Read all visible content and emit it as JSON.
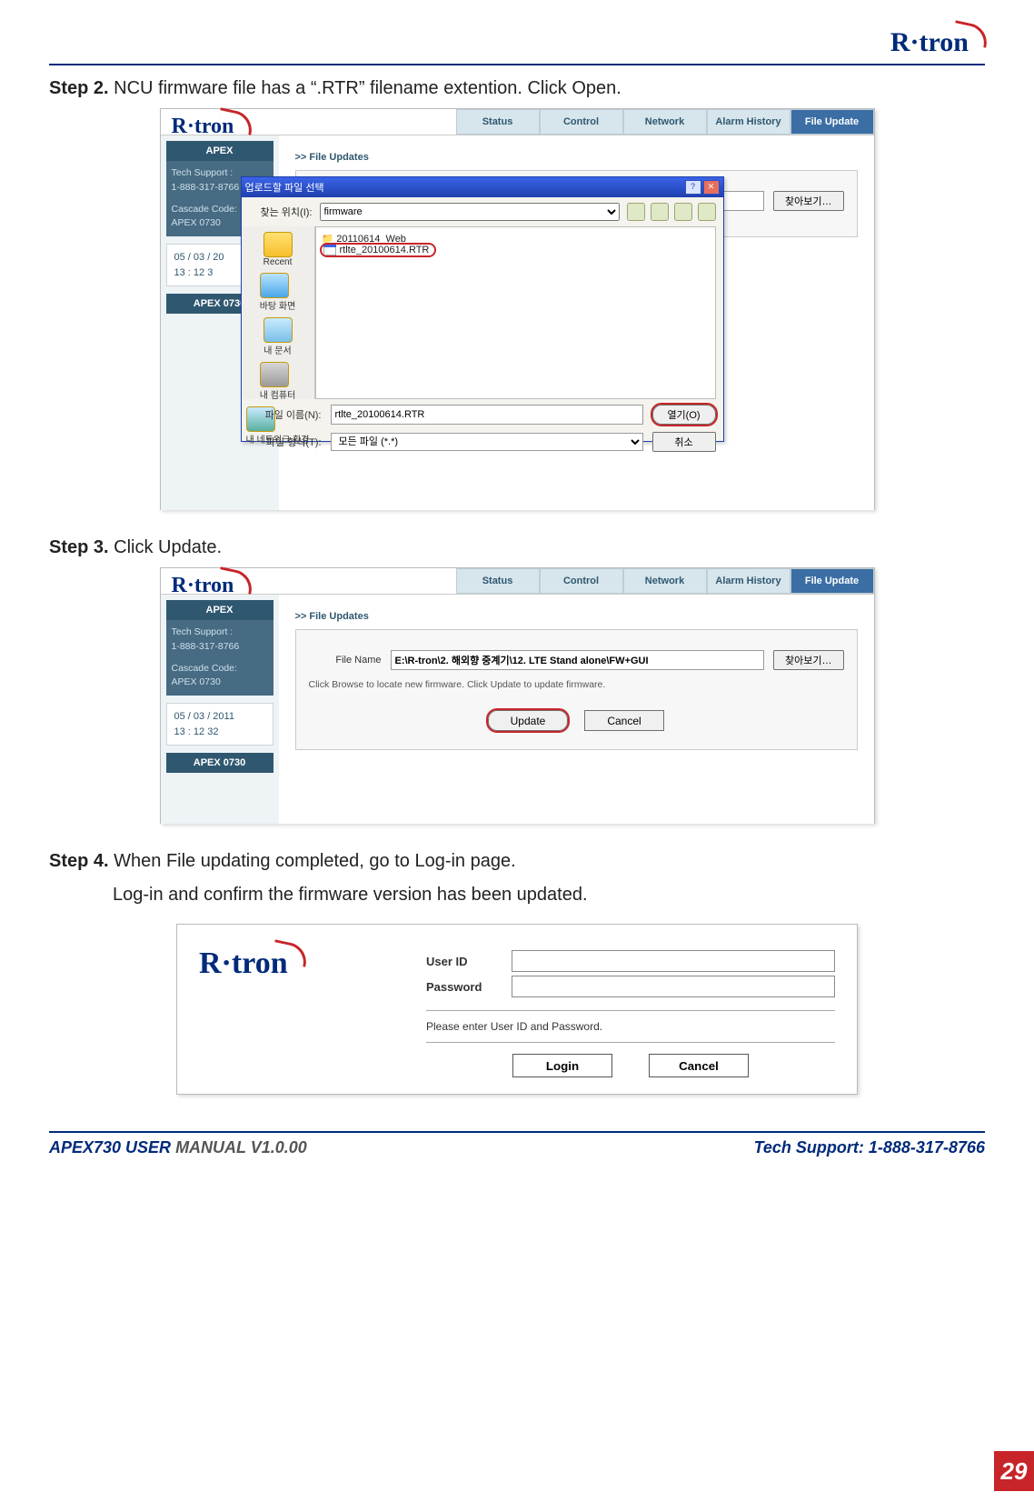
{
  "brand": "R·tron",
  "steps": {
    "s2": {
      "label": "Step 2.",
      "text": "NCU firmware file has a “.RTR” filename extention. Click Open."
    },
    "s3": {
      "label": "Step 3.",
      "text": "Click Update."
    },
    "s4": {
      "label": "Step 4.",
      "text1": "When File updating completed, go to Log-in page.",
      "text2": "Log-in and confirm the firmware version has been updated."
    }
  },
  "tabs": {
    "status": "Status",
    "control": "Control",
    "network": "Network",
    "alarm": "Alarm History",
    "file": "File Update"
  },
  "sidebar": {
    "title": "APEX",
    "tech_label": "Tech Support :",
    "tech_phone": "1-888-317-8766",
    "cascade_label": "Cascade Code:",
    "cascade_value": "APEX 0730",
    "date1": "05 /  03 /  20",
    "time1": "13 :  12    3",
    "date2": "05 /  03 /  2011",
    "time2": "13 :  12    32",
    "footer_box": "APEX 0730"
  },
  "fileupdate": {
    "section": ">> File Updates",
    "filename_label": "File Name",
    "browse": "찾아보기…",
    "path_value": "E:\\R-tron\\2. 해외향 중계기\\12. LTE Stand alone\\FW+GUI",
    "hint": "Click Browse to locate new firmware. Click Update to update firmware.",
    "update": "Update",
    "cancel": "Cancel"
  },
  "dialog": {
    "title": "업로드할 파일 선택",
    "lookin_label": "찾는 위치(I):",
    "lookin_value": "firmware",
    "places": {
      "recent": "Recent",
      "desktop": "바탕 화면",
      "mydocs": "내 문서",
      "mypc": "내 컴퓨터",
      "mynet": "내 네트워크 환경"
    },
    "folder": "20110614_Web",
    "file": "rtlte_20100614.RTR",
    "filename_label": "파일 이름(N):",
    "filename_value": "rtlte_20100614.RTR",
    "filetype_label": "파일 형식(T):",
    "filetype_value": "모든 파일 (*.*)",
    "open": "열기(O)",
    "cancel": "취소"
  },
  "login": {
    "user_label": "User ID",
    "pass_label": "Password",
    "hint": "Please enter User ID and Password.",
    "login": "Login",
    "cancel": "Cancel"
  },
  "footer": {
    "manual_a": "APEX730 USER",
    "manual_b": " MANUAL V1.0.00",
    "support": "Tech Support: 1-888-317-8766",
    "page": "29"
  }
}
